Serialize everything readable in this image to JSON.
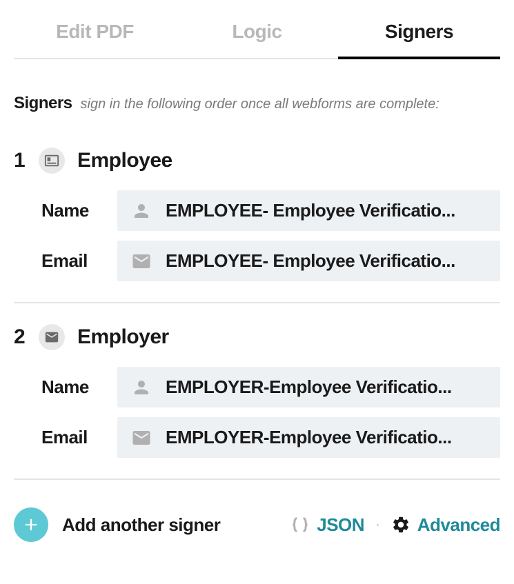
{
  "tabs": {
    "edit_pdf": "Edit PDF",
    "logic": "Logic",
    "signers": "Signers"
  },
  "section": {
    "title": "Signers",
    "subtitle": "sign in the following order once all webforms are complete:"
  },
  "signers": [
    {
      "number": "1",
      "name": "Employee",
      "name_value": "EMPLOYEE- Employee Verificatio...",
      "email_value": "EMPLOYEE- Employee Verificatio..."
    },
    {
      "number": "2",
      "name": "Employer",
      "name_value": "EMPLOYER-Employee Verificatio...",
      "email_value": "EMPLOYER-Employee Verificatio..."
    }
  ],
  "labels": {
    "name": "Name",
    "email": "Email"
  },
  "footer": {
    "add_signer": "Add another signer",
    "json": "JSON",
    "advanced": "Advanced"
  }
}
